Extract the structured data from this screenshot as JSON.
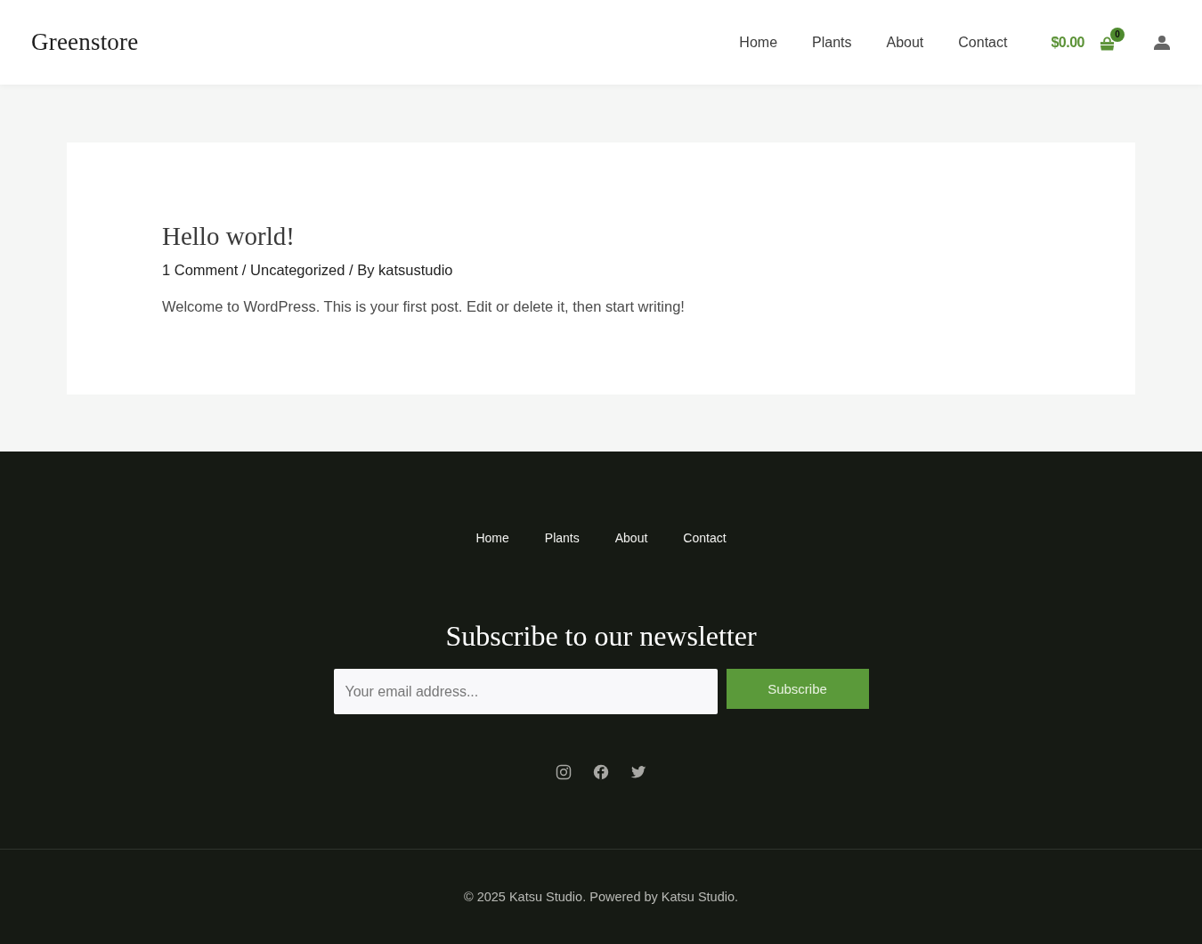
{
  "header": {
    "logo": "Greenstore",
    "nav": [
      {
        "label": "Home"
      },
      {
        "label": "Plants"
      },
      {
        "label": "About"
      },
      {
        "label": "Contact"
      }
    ],
    "cart": {
      "total": "$0.00",
      "count": "0"
    }
  },
  "post": {
    "title": "Hello world!",
    "meta": {
      "separator": "/",
      "items": [
        {
          "text": "1 Comment"
        },
        {
          "text": "Uncategorized"
        },
        {
          "prefix": "By",
          "text": "katsustudio"
        }
      ]
    },
    "body": "Welcome to WordPress. This is your first post. Edit or delete it, then start writing!"
  },
  "footer": {
    "nav": [
      {
        "label": "Home"
      },
      {
        "label": "Plants"
      },
      {
        "label": "About"
      },
      {
        "label": "Contact"
      }
    ],
    "newsletter": {
      "heading": "Subscribe to our newsletter",
      "placeholder": "Your email address...",
      "button": "Subscribe"
    },
    "social": [
      {
        "kind": "instagram"
      },
      {
        "kind": "facebook"
      },
      {
        "kind": "twitter"
      }
    ],
    "copyright": "© 2025 Katsu Studio. Powered by Katsu Studio."
  }
}
